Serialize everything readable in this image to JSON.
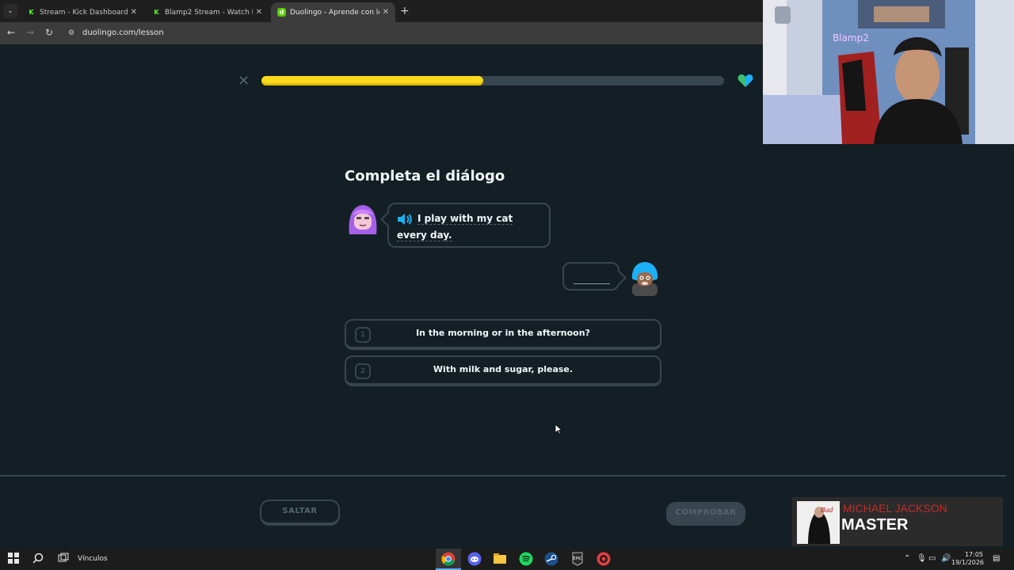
{
  "browser": {
    "tabs": [
      {
        "label": "Stream - Kick Dashboard",
        "favicon": "kick-icon",
        "active": false
      },
      {
        "label": "Blamp2 Stream - Watch Live on",
        "favicon": "kick-icon",
        "active": false
      },
      {
        "label": "Duolingo - Aprende con leccio",
        "favicon": "duolingo-icon",
        "active": true
      }
    ],
    "url": "duolingo.com/lesson"
  },
  "lesson": {
    "progress_fraction": 0.48,
    "title": "Completa el diálogo",
    "prompt_text": "I play with my cat every day.",
    "options": [
      {
        "num": "1",
        "text": "In the morning or in the afternoon?"
      },
      {
        "num": "2",
        "text": "With milk and sugar, please."
      }
    ],
    "skip_label": "SALTAR",
    "check_label": "COMPROBAR"
  },
  "overlay": {
    "now_playing_artist": "MICHAEL JACKSON",
    "now_playing_song": "MASTER"
  },
  "taskbar": {
    "links_label": "Vínculos",
    "time": "17:05",
    "date": "19/1/2026"
  },
  "colors": {
    "background": "#131f24",
    "progress": "#fad91e",
    "border": "#37464f",
    "text": "#f1f7fb"
  }
}
